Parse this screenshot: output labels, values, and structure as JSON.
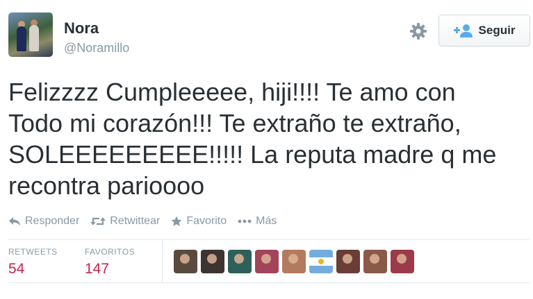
{
  "header": {
    "name": "Nora",
    "handle": "@Noramillo",
    "follow_label": "Seguir"
  },
  "tweet": {
    "text": "Felizzzz Cumpleeeee, hiji!!!! Te amo con\nTodo mi corazón!!! Te extraño te extraño,\nSOLEEEEEEEEE!!!!! La reputa madre q me\nrecontra parioooo"
  },
  "actions": {
    "reply_label": "Responder",
    "retweet_label": "Retwittear",
    "favorite_label": "Favorito",
    "more_label": "Más"
  },
  "stats": {
    "retweets_label": "RETWEETS",
    "retweets_value": "54",
    "favorites_label": "FAVORITOS",
    "favorites_value": "147"
  },
  "favoriters": [
    {
      "icon": "user-avatar",
      "color": "#5a4a3e"
    },
    {
      "icon": "user-avatar",
      "color": "#3b3430"
    },
    {
      "icon": "user-avatar",
      "color": "#2e5f5a"
    },
    {
      "icon": "user-avatar",
      "color": "#a2445a"
    },
    {
      "icon": "user-avatar",
      "color": "#b27a5e"
    },
    {
      "icon": "argentina-flag-avatar",
      "color": "#74acdf"
    },
    {
      "icon": "user-avatar",
      "color": "#6a3d36"
    },
    {
      "icon": "user-avatar",
      "color": "#8a5a48"
    },
    {
      "icon": "user-avatar",
      "color": "#9c3a4a"
    }
  ],
  "colors": {
    "stat_value": "#c7254e",
    "muted": "#8899a6",
    "accent": "#55acee"
  }
}
